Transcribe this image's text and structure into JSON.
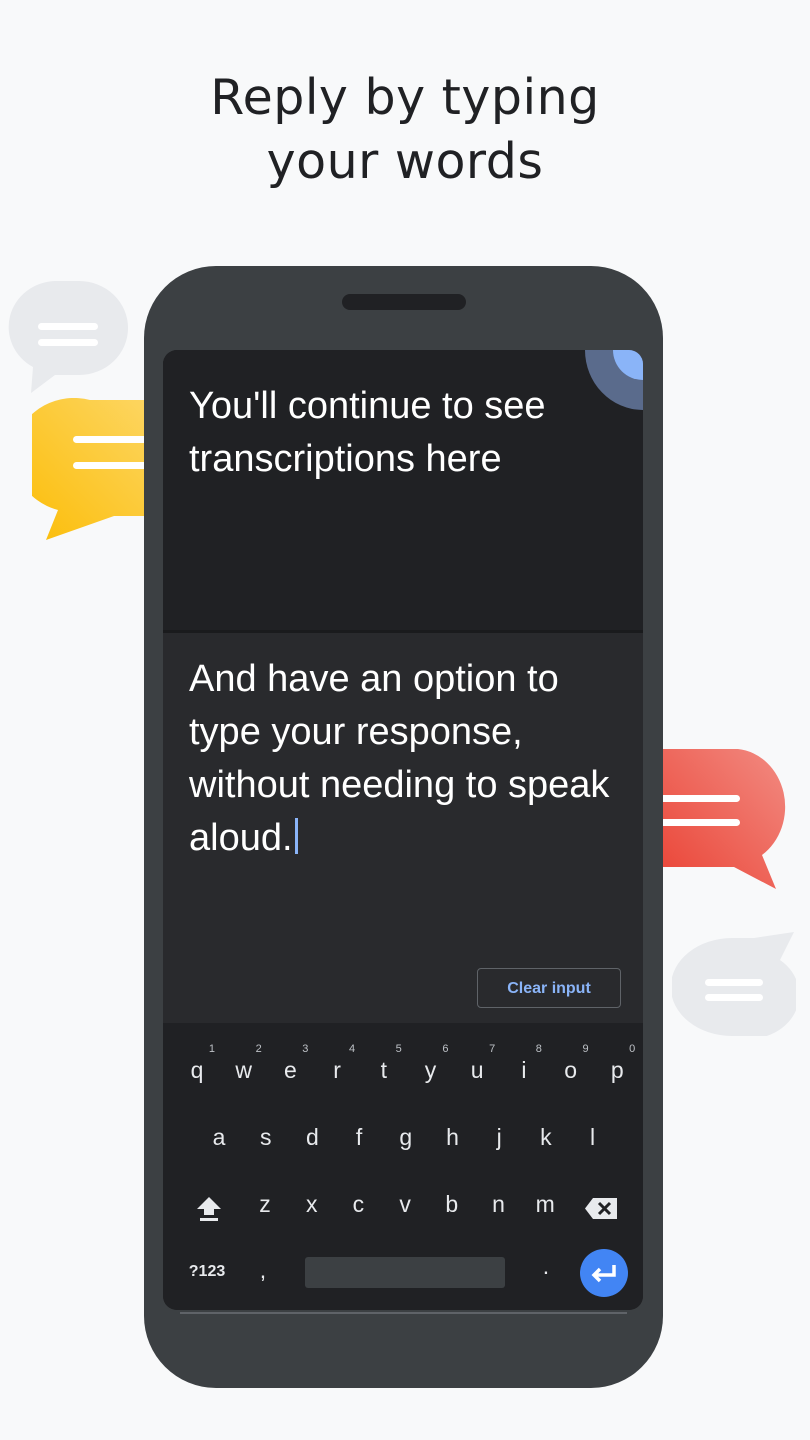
{
  "headline": {
    "line1": "Reply by typing",
    "line2": "your words"
  },
  "decor": {
    "bubbles": [
      {
        "name": "gray-bubble-top-left",
        "color": "#e8eaed"
      },
      {
        "name": "yellow-bubble",
        "color": "#fbc02d"
      },
      {
        "name": "red-bubble",
        "color": "#ea6a5c"
      },
      {
        "name": "gray-bubble-bottom-right",
        "color": "#e8eaed"
      }
    ]
  },
  "screen": {
    "transcript": "You'll continue to see transcriptions here",
    "reply": "And have an option to type your response, without needing to speak aloud.",
    "clear_button": "Clear input"
  },
  "keyboard": {
    "row1": [
      {
        "key": "q",
        "hint": "1"
      },
      {
        "key": "w",
        "hint": "2"
      },
      {
        "key": "e",
        "hint": "3"
      },
      {
        "key": "r",
        "hint": "4"
      },
      {
        "key": "t",
        "hint": "5"
      },
      {
        "key": "y",
        "hint": "6"
      },
      {
        "key": "u",
        "hint": "7"
      },
      {
        "key": "i",
        "hint": "8"
      },
      {
        "key": "o",
        "hint": "9"
      },
      {
        "key": "p",
        "hint": "0"
      }
    ],
    "row2": [
      "a",
      "s",
      "d",
      "f",
      "g",
      "h",
      "j",
      "k",
      "l"
    ],
    "row3": [
      "z",
      "x",
      "c",
      "v",
      "b",
      "n",
      "m"
    ],
    "symbols_label": "?123",
    "comma": ",",
    "period": ".",
    "icons": {
      "shift": "shift-icon",
      "backspace": "backspace-icon",
      "enter": "enter-icon"
    },
    "accent": "#4285f4"
  }
}
